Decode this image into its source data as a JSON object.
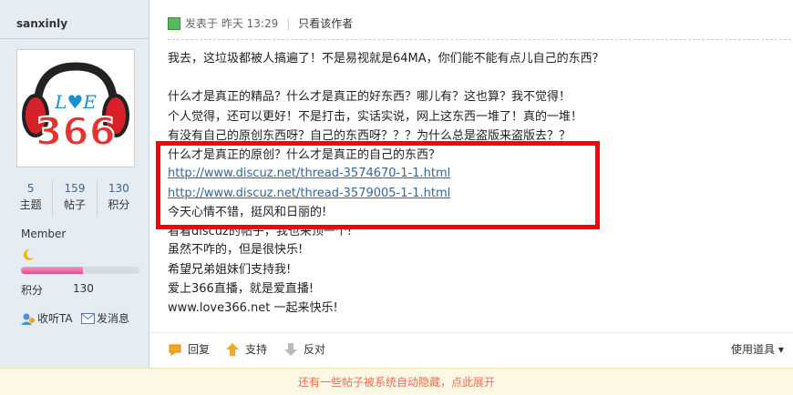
{
  "author": {
    "username": "sanxinly",
    "avatar_text": "366",
    "stats": [
      {
        "value": "5",
        "label": "主题"
      },
      {
        "value": "159",
        "label": "帖子"
      },
      {
        "value": "130",
        "label": "积分"
      }
    ],
    "group": "Member",
    "credit_label": "积分",
    "credit_value": "130",
    "progress": 0.52,
    "follow_label": "收听TA",
    "message_label": "发消息"
  },
  "post": {
    "posted_label": "发表于",
    "posted_time": "昨天 13:29",
    "author_only_label": "只看该作者",
    "lines": [
      "我去，这垃圾都被人搞遍了！不是易视就是64MA，你们能不能有点儿自己的东西？",
      "",
      "什么才是真正的精品？什么才是真正的好东西？哪儿有？这也算？我不觉得！",
      "个人觉得，还可以更好！不是打击，实话实说，网上这东西一堆了！真的一堆！",
      "有没有自己的原创东西呀？自己的东西呀？？？为什么总是盗版来盗版去？？",
      "什么才是真正的原创？什么才是真正的自己的东西？",
      "http://www.discuz.net/thread-3574670-1-1.html",
      "http://www.discuz.net/thread-3579005-1-1.html",
      "今天心情不错，挺风和日丽的!",
      "看着discuz的帖子，我也来顶一个!",
      "虽然不咋的，但是很快乐!",
      "希望兄弟姐妹们支持我!",
      "爱上366直播，就是爱直播!",
      "www.love366.net 一起来快乐!"
    ],
    "reply_label": "回复",
    "support_label": "支持",
    "oppose_label": "反对",
    "tools_label": "使用道具"
  },
  "notice": "还有一些帖子被系统自动隐藏，点此展开",
  "colors": {
    "accent": "#336699",
    "highlight_box": "#ff0000",
    "notice_text": "#f26c4f"
  }
}
